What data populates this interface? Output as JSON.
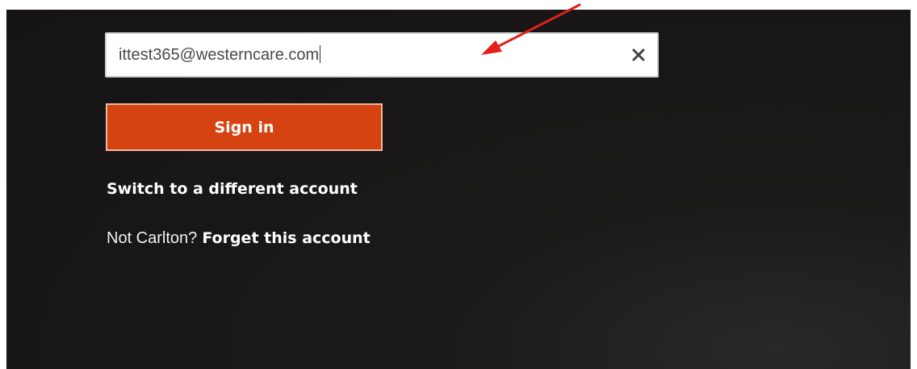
{
  "login": {
    "email_value": "ittest365@westerncare.com",
    "clear_icon": "close-icon",
    "sign_in_label": "Sign in",
    "switch_account_label": "Switch to a different account",
    "not_user_text": "Not Carlton?",
    "forget_account_label": "Forget this account"
  },
  "colors": {
    "background": "#181616",
    "accent": "#d54310",
    "annotation_arrow": "#e0201b"
  },
  "annotation": {
    "type": "arrow",
    "points_to": "email-field"
  }
}
